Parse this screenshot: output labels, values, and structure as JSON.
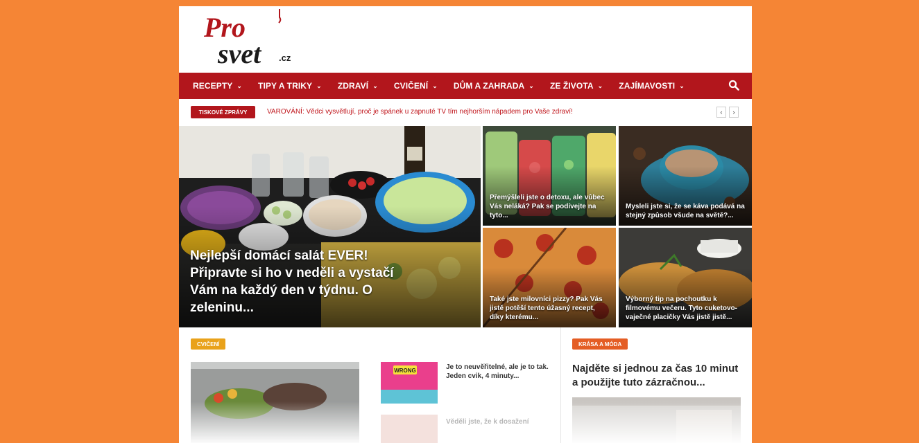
{
  "site": {
    "logo_text_top": "Pro",
    "logo_text_bottom": "svet",
    "logo_tld": ".cz"
  },
  "nav": {
    "items": [
      {
        "label": "RECEPTY"
      },
      {
        "label": "TIPY A TRIKY"
      },
      {
        "label": "ZDRAVÍ"
      },
      {
        "label": "CVIČENÍ"
      },
      {
        "label": "DŮM A ZAHRADA"
      },
      {
        "label": "ZE ŽIVOTA"
      },
      {
        "label": "ZAJÍMAVOSTI"
      }
    ],
    "search_icon": "search-icon"
  },
  "ticker": {
    "badge": "TISKOVÉ ZPRÁVY",
    "headline": "VAROVÁNÍ: Vědci vysvětlují, proč je spánek u zapnuté TV tím nejhorším nápadem pro Vaše zdraví!",
    "prev": "‹",
    "next": "›"
  },
  "hero": {
    "main": "Nejlepší domácí salát EVER! Připravte si ho v neděli a vystačí Vám na každý den v týdnu. O zeleninu...",
    "tiles": [
      "Přemýšleli jste o detoxu, ale vůbec Vás neláká? Pak se podívejte na tyto...",
      "Mysleli jste si, že se káva podává na stejný způsob všude na světě?...",
      "Také jste milovníci pizzy? Pak Vás jistě potěší tento úžasný recept, díky kterému...",
      "Výborný tip na pochoutku k filmovému večeru. Tyto cuketovo-vaječné placičky Vás jistě jistě..."
    ]
  },
  "sections": {
    "left": {
      "badge": "CVIČENÍ",
      "badge_color": "#e9a21b",
      "posts": [
        "Je to neuvěřitelné, ale je to tak. Jeden cvik, 4 minuty...",
        "Věděli jste, že k dosažení"
      ],
      "thumb_label": "WRONG"
    },
    "right": {
      "badge": "KRÁSA A MÓDA",
      "badge_color": "#e45d24",
      "headline": "Najděte si jednou za čas 10 minut a použijte tuto zázračnou..."
    }
  },
  "colors": {
    "background": "#f58535",
    "nav": "#b2161c",
    "accent_red": "#c0161c"
  }
}
